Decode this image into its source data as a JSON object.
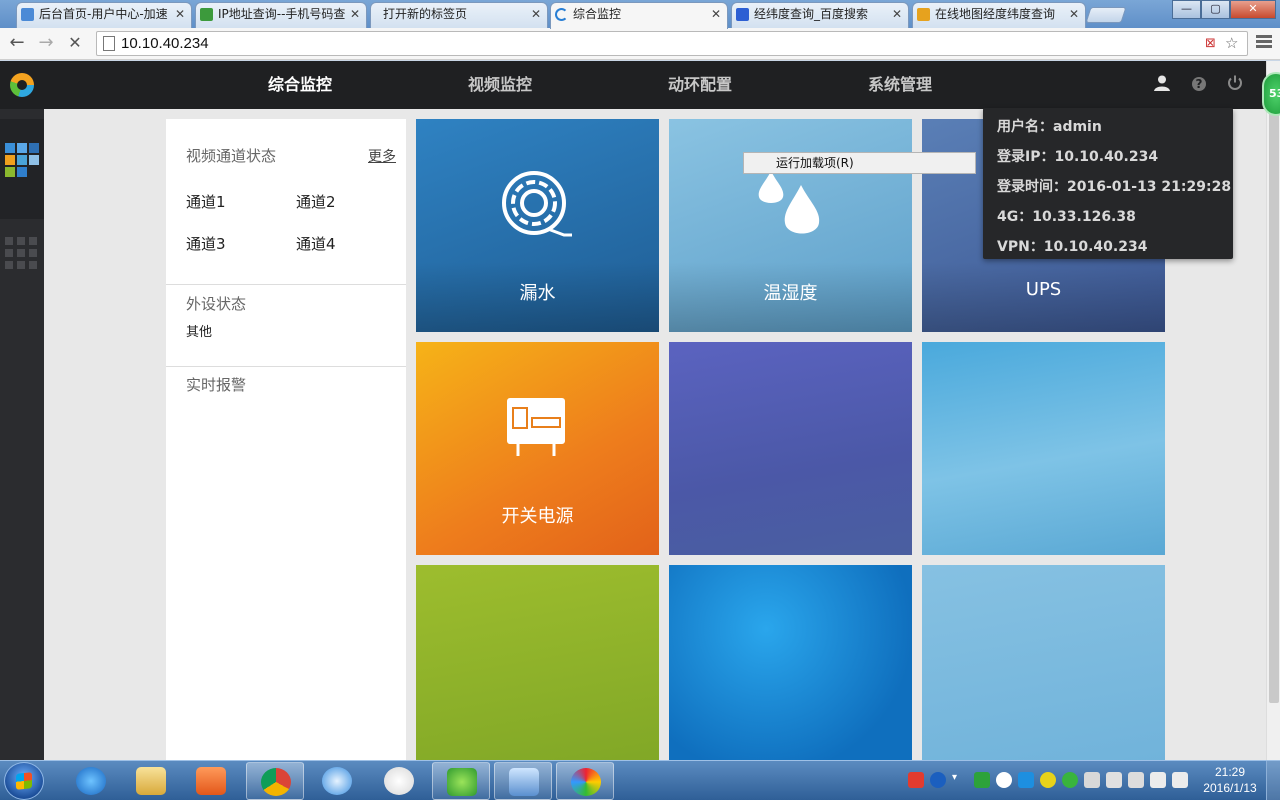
{
  "browser": {
    "tabs": [
      {
        "title": "后台首页-用户中心-加速",
        "color": "#4b8ad6"
      },
      {
        "title": "IP地址查询--手机号码查",
        "color": "#3c9a3c"
      },
      {
        "title": "打开新的标签页",
        "color": ""
      },
      {
        "title": "综合监控",
        "color": "#2a7fd4"
      },
      {
        "title": "经纬度查询_百度搜索",
        "color": "#2d5fd3"
      },
      {
        "title": "在线地图经度纬度查询",
        "color": "#e6a21e"
      }
    ],
    "window_controls": {
      "minimize": "—",
      "maximize": "▢",
      "close": "✕"
    },
    "address": "10.10.40.234",
    "back_glyph": "←",
    "forward_glyph": "→",
    "stop_glyph": "✕",
    "star_glyph": "☆"
  },
  "app": {
    "nav": [
      "综合监控",
      "视频监控",
      "动环配置",
      "系统管理"
    ],
    "active_nav": "综合监控",
    "header_icons": [
      "user-icon",
      "help-icon",
      "power-icon"
    ]
  },
  "panel": {
    "video_status": {
      "title": "视频通道状态",
      "more": "更多",
      "channels": [
        "通道1",
        "通道2",
        "通道3",
        "通道4"
      ]
    },
    "peripheral": {
      "title": "外设状态",
      "item": "其他"
    },
    "alarm": {
      "title": "实时报警"
    }
  },
  "tiles": [
    {
      "label": "漏水",
      "icon": "water-leak-icon",
      "bg": "#2b77b4"
    },
    {
      "label": "温湿度",
      "icon": "humidity-icon",
      "bg": "#79b6da"
    },
    {
      "label": "UPS",
      "icon": "",
      "bg": "#4d6da5"
    },
    {
      "label": "开关电源",
      "icon": "power-supply-icon",
      "bg": "#ef8a1a"
    },
    {
      "label": "",
      "icon": "",
      "bg": "#5a5fb8"
    },
    {
      "label": "",
      "icon": "",
      "bg": "#5db3dd"
    },
    {
      "label": "",
      "icon": "",
      "bg": "#8fb52c"
    },
    {
      "label": "",
      "icon": "",
      "bg": "#1f8ed6"
    },
    {
      "label": "",
      "icon": "",
      "bg": "#7fbde0"
    }
  ],
  "context_menu": {
    "item": "运行加载项(R)"
  },
  "user_popover": {
    "username": "用户名：admin",
    "login_ip": "登录IP：10.10.40.234",
    "login_time": "登录时间：2016-01-13 21:29:28",
    "ip_4g": "4G：10.33.126.38",
    "vpn": "VPN：10.10.40.234"
  },
  "badge": "53",
  "taskbar": {
    "time": "21:29",
    "date": "2016/1/13"
  }
}
